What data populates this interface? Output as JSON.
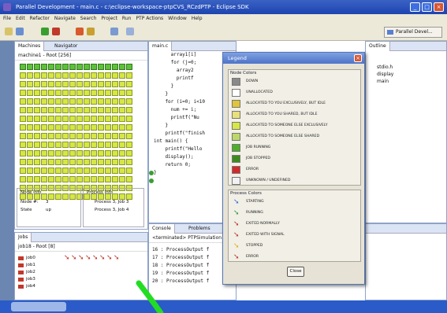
{
  "window": {
    "title": "Parallel Development - main.c - c:\\eclipse-workspace-ptpCVS_RCzdPTP - Eclipse SDK"
  },
  "menu": [
    "File",
    "Edit",
    "Refactor",
    "Navigate",
    "Search",
    "Project",
    "Run",
    "PTP Actions",
    "Window",
    "Help"
  ],
  "perspective": "Parallel Devel...",
  "machines": {
    "tab1": "Machines",
    "tab2": "Navigator",
    "root": "machine1 - Root [256]"
  },
  "node_info": {
    "title": "Node Info",
    "k1": "Node #:",
    "v1": "3",
    "k2": "State",
    "v2": "up"
  },
  "proc_info": {
    "title": "Process Info",
    "p1": "Process 3, Job 3",
    "p2": "Process 3, Job 4"
  },
  "editor": {
    "tab": "main.c"
  },
  "code": [
    "      array1[i]",
    "      for (j=0;",
    "        array2",
    "        printf",
    "      }",
    "    }",
    "",
    "    for (i=0; i<10",
    "      num += i;",
    "      printf(\"Nu",
    "    }",
    "    printf(\"finish",
    "",
    "int main() {",
    "    printf(\"Hello",
    "    display();",
    "    return 0;",
    "}"
  ],
  "outline": {
    "tab": "Outline",
    "items": [
      "stdio.h",
      "display",
      "main"
    ]
  },
  "console": {
    "tab": "Console",
    "tab2": "Problems",
    "status": "<terminated> PTPSimulation [Par",
    "lines": [
      "16 : ProcessOutput f",
      "17 : ProcessOutput f",
      "18 : ProcessOutput f",
      "19 : ProcessOutput f",
      "20 : ProcessOutput f"
    ]
  },
  "jobs": {
    "tab": "Jobs",
    "root": "job18 - Root [8]",
    "items": [
      "job0",
      "job1",
      "job2",
      "job3",
      "job4"
    ]
  },
  "legend": {
    "title": "Legend",
    "node_group": "Node Colors",
    "nodes": [
      {
        "label": "DOWN",
        "color": "#8a8a8a"
      },
      {
        "label": "UNALLOCATED",
        "color": "#ffffff"
      },
      {
        "label": "ALLOCATED TO YOU EXCLUSIVELY, BUT IDLE",
        "color": "#e0c43a"
      },
      {
        "label": "ALLOCATED TO YOU SHARED, BUT IDLE",
        "color": "#e8e07a"
      },
      {
        "label": "ALLOCATED TO SOMEONE ELSE EXCLUSIVELY",
        "color": "#d6e645"
      },
      {
        "label": "ALLOCATED TO SOMEONE ELSE SHARED",
        "color": "#bcd86a"
      },
      {
        "label": "JOB RUNNING",
        "color": "#4fae2a"
      },
      {
        "label": "JOB STOPPED",
        "color": "#3d8a1d"
      },
      {
        "label": "ERROR",
        "color": "#d22a2a"
      },
      {
        "label": "UNKNOWN / UNDEFINED",
        "color": "#f2f2f2"
      }
    ],
    "process_group": "Process Colors",
    "processes": [
      {
        "label": "STARTING",
        "color": "#3a6fd0"
      },
      {
        "label": "RUNNING",
        "color": "#2f9e3a"
      },
      {
        "label": "EXITED NORMALLY",
        "color": "#c0392b"
      },
      {
        "label": "EXITED WITH SIGNAL",
        "color": "#c0392b"
      },
      {
        "label": "STOPPED",
        "color": "#e0b020"
      },
      {
        "label": "ERROR",
        "color": "#c0392b"
      }
    ],
    "close": "Close"
  }
}
